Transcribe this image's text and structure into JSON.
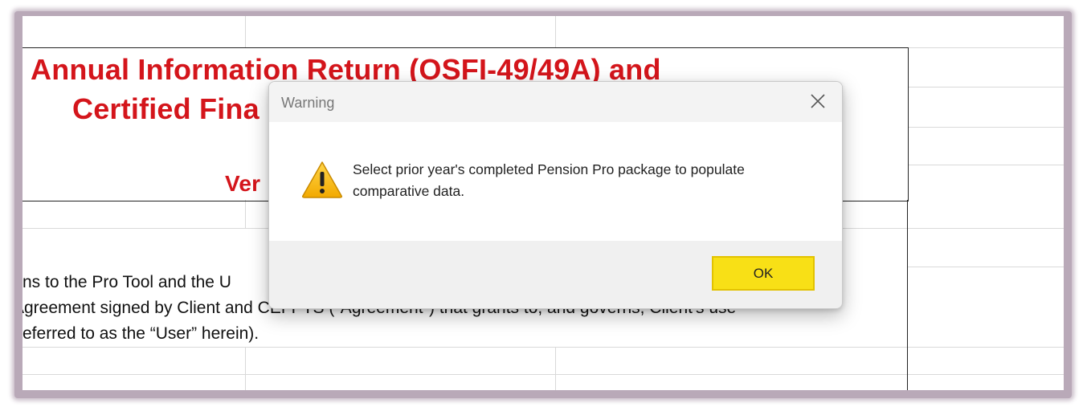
{
  "sheet": {
    "title_line1": "Annual Information Return (OSFI-49/49A) and",
    "title_line2": "Certified Fina",
    "title_line3": "Ver",
    "body_line1": "ns to the Pro Tool and the U",
    "body_line2": "Agreement signed by Client and CEFPTS (\"Agreement\") that grants to, and governs, Client's use",
    "body_line3": "eferred to as the “User” herein)."
  },
  "dialog": {
    "title": "Warning",
    "icon": "warning-triangle-icon",
    "message": "Select prior year's completed Pension Pro package to populate comparative data.",
    "ok_label": "OK",
    "close_icon": "close-icon"
  },
  "colors": {
    "title_red": "#d4151b",
    "ok_yellow": "#f8e016",
    "frame": "#b9a9b8"
  }
}
